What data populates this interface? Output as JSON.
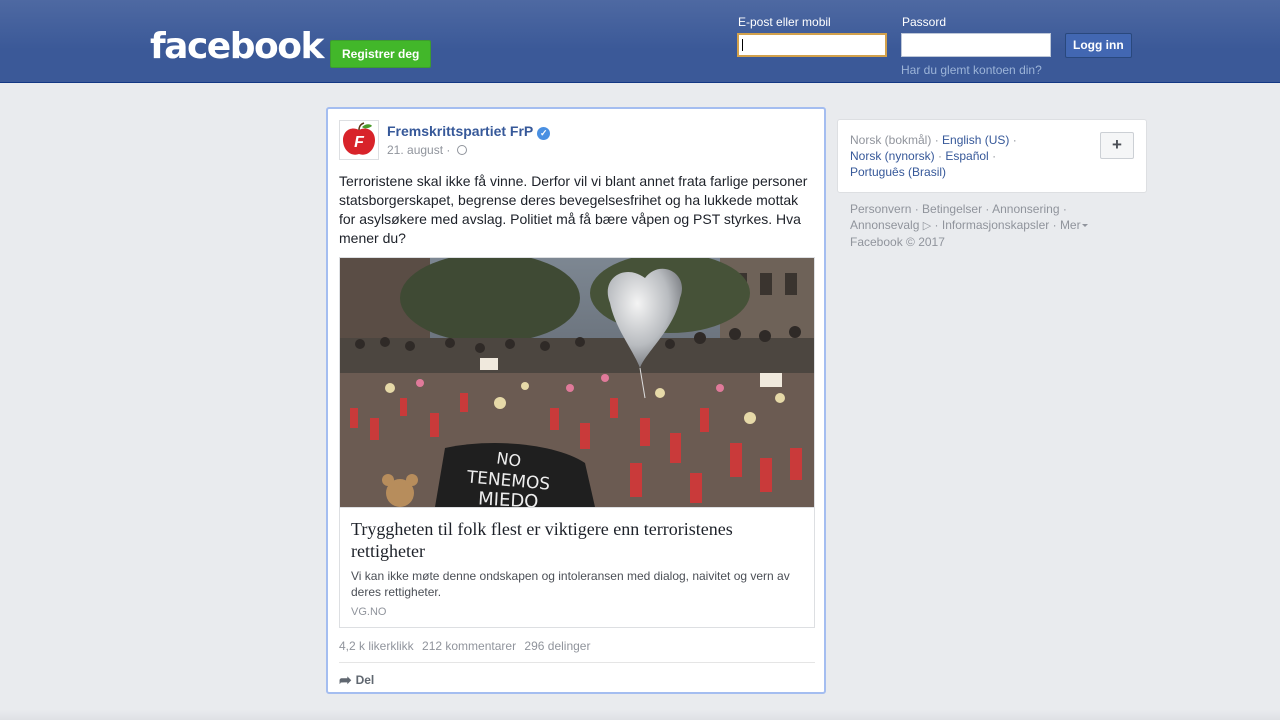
{
  "header": {
    "logo": "facebook",
    "signup_label": "Registrer deg",
    "email_label": "E-post eller mobil",
    "password_label": "Passord",
    "login_label": "Logg inn",
    "forgot_label": "Har du glemt kontoen din?"
  },
  "post": {
    "page_name": "Fremskrittspartiet FrP",
    "date": "21. august ·",
    "text": "Terroristene skal ikke få vinne. Derfor vil vi blant annet frata farlige personer statsborgerskapet, begrense deres bevegelsesfrihet og ha lukkede mottak for asylsøkere med avslag. Politiet må få bære våpen og PST styrkes. Hva mener du?",
    "link": {
      "title": "Tryggheten til folk flest er viktigere enn terroristenes rettigheter",
      "description": "Vi kan ikke møte denne ondskapen og intoleransen med dialog, naivitet og vern av deres rettigheter.",
      "domain": "VG.NO",
      "image_sign": [
        "NO",
        "TENEMOS",
        "MIEDO"
      ]
    },
    "stats": {
      "likes": "4,2 k likerklikk",
      "comments": "212 kommentarer",
      "shares": "296 delinger"
    },
    "share_label": "Del"
  },
  "languages": {
    "current": "Norsk (bokmål)",
    "options": [
      "English (US)",
      "Norsk (nynorsk)",
      "Español",
      "Português (Brasil)"
    ],
    "plus": "+"
  },
  "footer": {
    "links": [
      "Personvern",
      "Betingelser",
      "Annonsering",
      "Annonsevalg",
      "Informasjonskapsler",
      "Mer"
    ],
    "copyright": "Facebook © 2017"
  },
  "colors": {
    "brand": "#3b5998",
    "signup_green": "#42b72a",
    "link_blue": "#365899"
  }
}
